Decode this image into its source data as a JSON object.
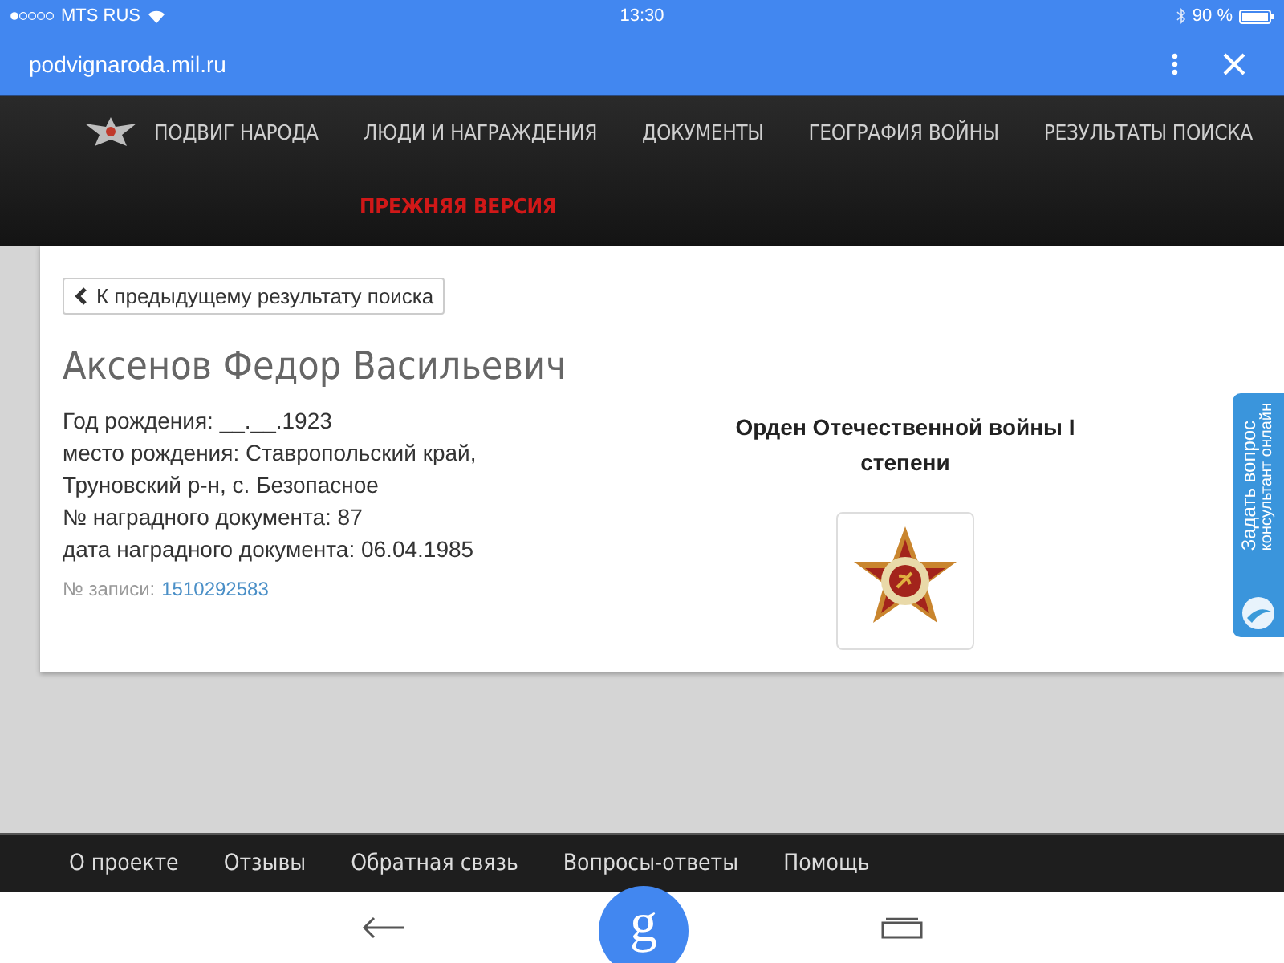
{
  "status_bar": {
    "carrier": "MTS RUS",
    "time": "13:30",
    "battery": "90 %"
  },
  "browser_bar": {
    "url": "podvignaroda.mil.ru"
  },
  "nav": {
    "items": [
      {
        "label": "ПОДВИГ НАРОДА",
        "kind": "main"
      },
      {
        "label": "ЛЮДИ И НАГРАЖДЕНИЯ",
        "kind": "main"
      },
      {
        "label": "ДОКУМЕНТЫ",
        "kind": "main"
      },
      {
        "label": "ГЕОГРАФИЯ ВОЙНЫ",
        "kind": "main"
      },
      {
        "label": "РЕЗУЛЬТАТЫ ПОИСКА",
        "kind": "main"
      },
      {
        "label": "ПРЕЖНЯЯ ВЕРСИЯ",
        "kind": "legacy"
      }
    ]
  },
  "record": {
    "back_button": "К предыдущему результату поиска",
    "name": "Аксенов Федор Васильевич",
    "details": [
      "Год рождения: __.__.1923",
      "место рождения: Ставропольский край,",
      "Труновский р-н, с. Безопасное",
      "№ наградного документа: 87",
      "дата наградного документа: 06.04.1985"
    ],
    "record_label": "№ записи:",
    "record_number": "1510292583",
    "award_title": "Орден Отечественной войны I степени"
  },
  "side_tab": {
    "title": "Задать вопрос",
    "subtitle": "консультант онлайн"
  },
  "footer": {
    "links": [
      "О проекте",
      "Отзывы",
      "Обратная связь",
      "Вопросы-ответы",
      "Помощь"
    ]
  },
  "bottom_bar": {
    "home_letter": "g"
  }
}
